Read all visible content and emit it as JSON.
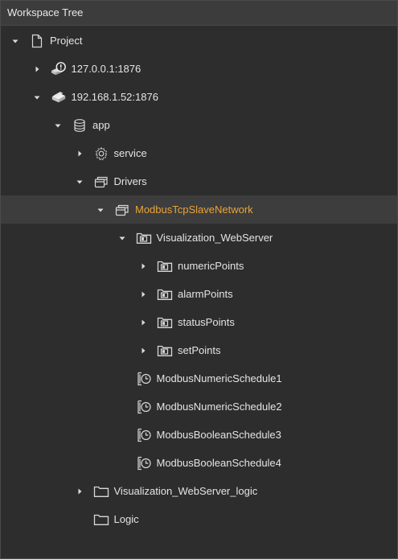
{
  "panel": {
    "title": "Workspace Tree"
  },
  "tree": [
    {
      "label": "Project",
      "depth": 0,
      "arrow": "down",
      "icon": "file-icon",
      "selected": false
    },
    {
      "label": "127.0.0.1:1876",
      "depth": 1,
      "arrow": "right",
      "icon": "server-alert-icon",
      "selected": false
    },
    {
      "label": "192.168.1.52:1876",
      "depth": 1,
      "arrow": "down",
      "icon": "server-icon",
      "selected": false
    },
    {
      "label": "app",
      "depth": 2,
      "arrow": "down",
      "icon": "database-icon",
      "selected": false
    },
    {
      "label": "service",
      "depth": 3,
      "arrow": "right",
      "icon": "gear-icon",
      "selected": false
    },
    {
      "label": "Drivers",
      "depth": 3,
      "arrow": "down",
      "icon": "drivers-icon",
      "selected": false
    },
    {
      "label": "ModbusTcpSlaveNetwork",
      "depth": 4,
      "arrow": "down",
      "icon": "drivers-icon",
      "selected": true
    },
    {
      "label": "Visualization_WebServer",
      "depth": 5,
      "arrow": "down",
      "icon": "device-folder-icon",
      "selected": false
    },
    {
      "label": "numericPoints",
      "depth": 6,
      "arrow": "right",
      "icon": "device-folder-icon",
      "selected": false
    },
    {
      "label": "alarmPoints",
      "depth": 6,
      "arrow": "right",
      "icon": "device-folder-icon",
      "selected": false
    },
    {
      "label": "statusPoints",
      "depth": 6,
      "arrow": "right",
      "icon": "device-folder-icon",
      "selected": false
    },
    {
      "label": "setPoints",
      "depth": 6,
      "arrow": "right",
      "icon": "device-folder-icon",
      "selected": false
    },
    {
      "label": "ModbusNumericSchedule1",
      "depth": 5,
      "arrow": "none",
      "icon": "schedule-icon",
      "selected": false
    },
    {
      "label": "ModbusNumericSchedule2",
      "depth": 5,
      "arrow": "none",
      "icon": "schedule-icon",
      "selected": false
    },
    {
      "label": "ModbusBooleanSchedule3",
      "depth": 5,
      "arrow": "none",
      "icon": "schedule-icon",
      "selected": false
    },
    {
      "label": "ModbusBooleanSchedule4",
      "depth": 5,
      "arrow": "none",
      "icon": "schedule-icon",
      "selected": false
    },
    {
      "label": "Visualization_WebServer_logic",
      "depth": 3,
      "arrow": "right",
      "icon": "folder-icon",
      "selected": false
    },
    {
      "label": "Logic",
      "depth": 3,
      "arrow": "none",
      "icon": "folder-icon",
      "selected": false
    }
  ],
  "colors": {
    "background": "#2d2d2d",
    "header": "#3c3c3c",
    "selected_row": "#3d3d3d",
    "selected_text": "#e8a33a",
    "text": "#e4e4e4"
  }
}
